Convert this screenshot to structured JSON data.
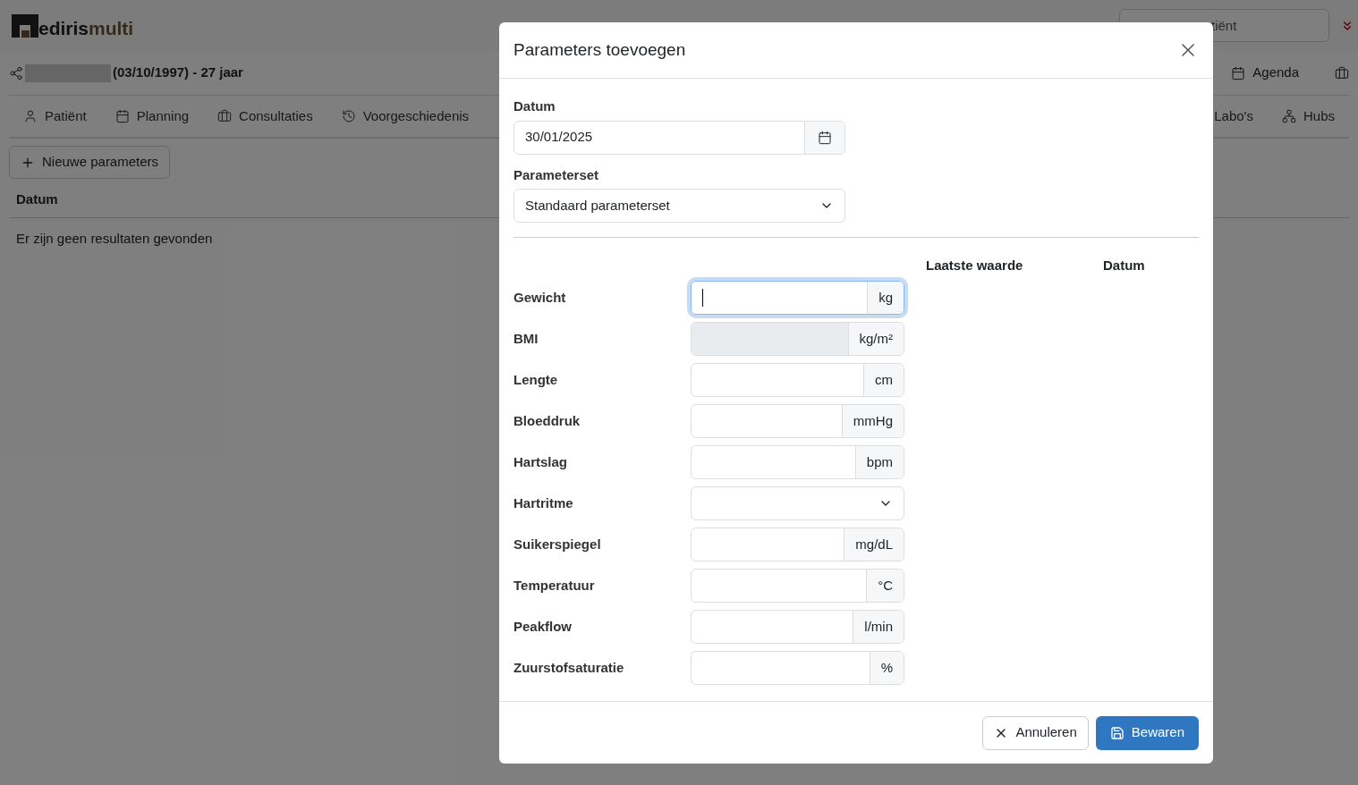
{
  "app": {
    "logo_first": "ediris",
    "logo_second": "multi",
    "search": {
      "placeholder": "tiënt"
    }
  },
  "patient": {
    "info": "(03/10/1997) - 27 jaar",
    "toolbar": [
      {
        "label": "Agenda"
      }
    ]
  },
  "tabs": [
    {
      "label": "Patiënt",
      "selected": false
    },
    {
      "label": "Planning",
      "selected": false
    },
    {
      "label": "Consultaties",
      "selected": false
    },
    {
      "label": "Voorgeschiedenis",
      "selected": false
    }
  ],
  "tabs_right": [
    {
      "label": "Labo's",
      "selected": false
    },
    {
      "label": "Hubs",
      "selected": false
    }
  ],
  "new_button": "Nieuwe parameters",
  "table": {
    "columns": [
      "Datum"
    ],
    "empty_text": "Er zijn geen resultaten gevonden"
  },
  "dialog": {
    "title": "Parameters toevoegen",
    "date_label": "Datum",
    "date_value": "30/01/2025",
    "set_label": "Parameterset",
    "set_value": "Standaard parameterset",
    "columns": [
      "Laatste waarde",
      "Datum"
    ],
    "parameters": [
      {
        "label": "Gewicht",
        "kind": "input",
        "unit": "kg",
        "disabled": false,
        "focused": true
      },
      {
        "label": "BMI",
        "kind": "input",
        "unit": "kg/m²",
        "disabled": true,
        "focused": false
      },
      {
        "label": "Lengte",
        "kind": "input",
        "unit": "cm",
        "disabled": false,
        "focused": false
      },
      {
        "label": "Bloeddruk",
        "kind": "input",
        "unit": "mmHg",
        "disabled": false,
        "focused": false
      },
      {
        "label": "Hartslag",
        "kind": "input",
        "unit": "bpm",
        "disabled": false,
        "focused": false
      },
      {
        "label": "Hartritme",
        "kind": "select",
        "disabled": false,
        "focused": false
      },
      {
        "label": "Suikerspiegel",
        "kind": "input",
        "unit": "mg/dL",
        "disabled": false,
        "focused": false
      },
      {
        "label": "Temperatuur",
        "kind": "input",
        "unit": "°C",
        "disabled": false,
        "focused": false
      },
      {
        "label": "Peakflow",
        "kind": "input",
        "unit": "l/min",
        "disabled": false,
        "focused": false
      },
      {
        "label": "Zuurstofsaturatie",
        "kind": "input",
        "unit": "%",
        "disabled": false,
        "focused": false
      }
    ],
    "cancel": "Annuleren",
    "save": "Bewaren"
  }
}
